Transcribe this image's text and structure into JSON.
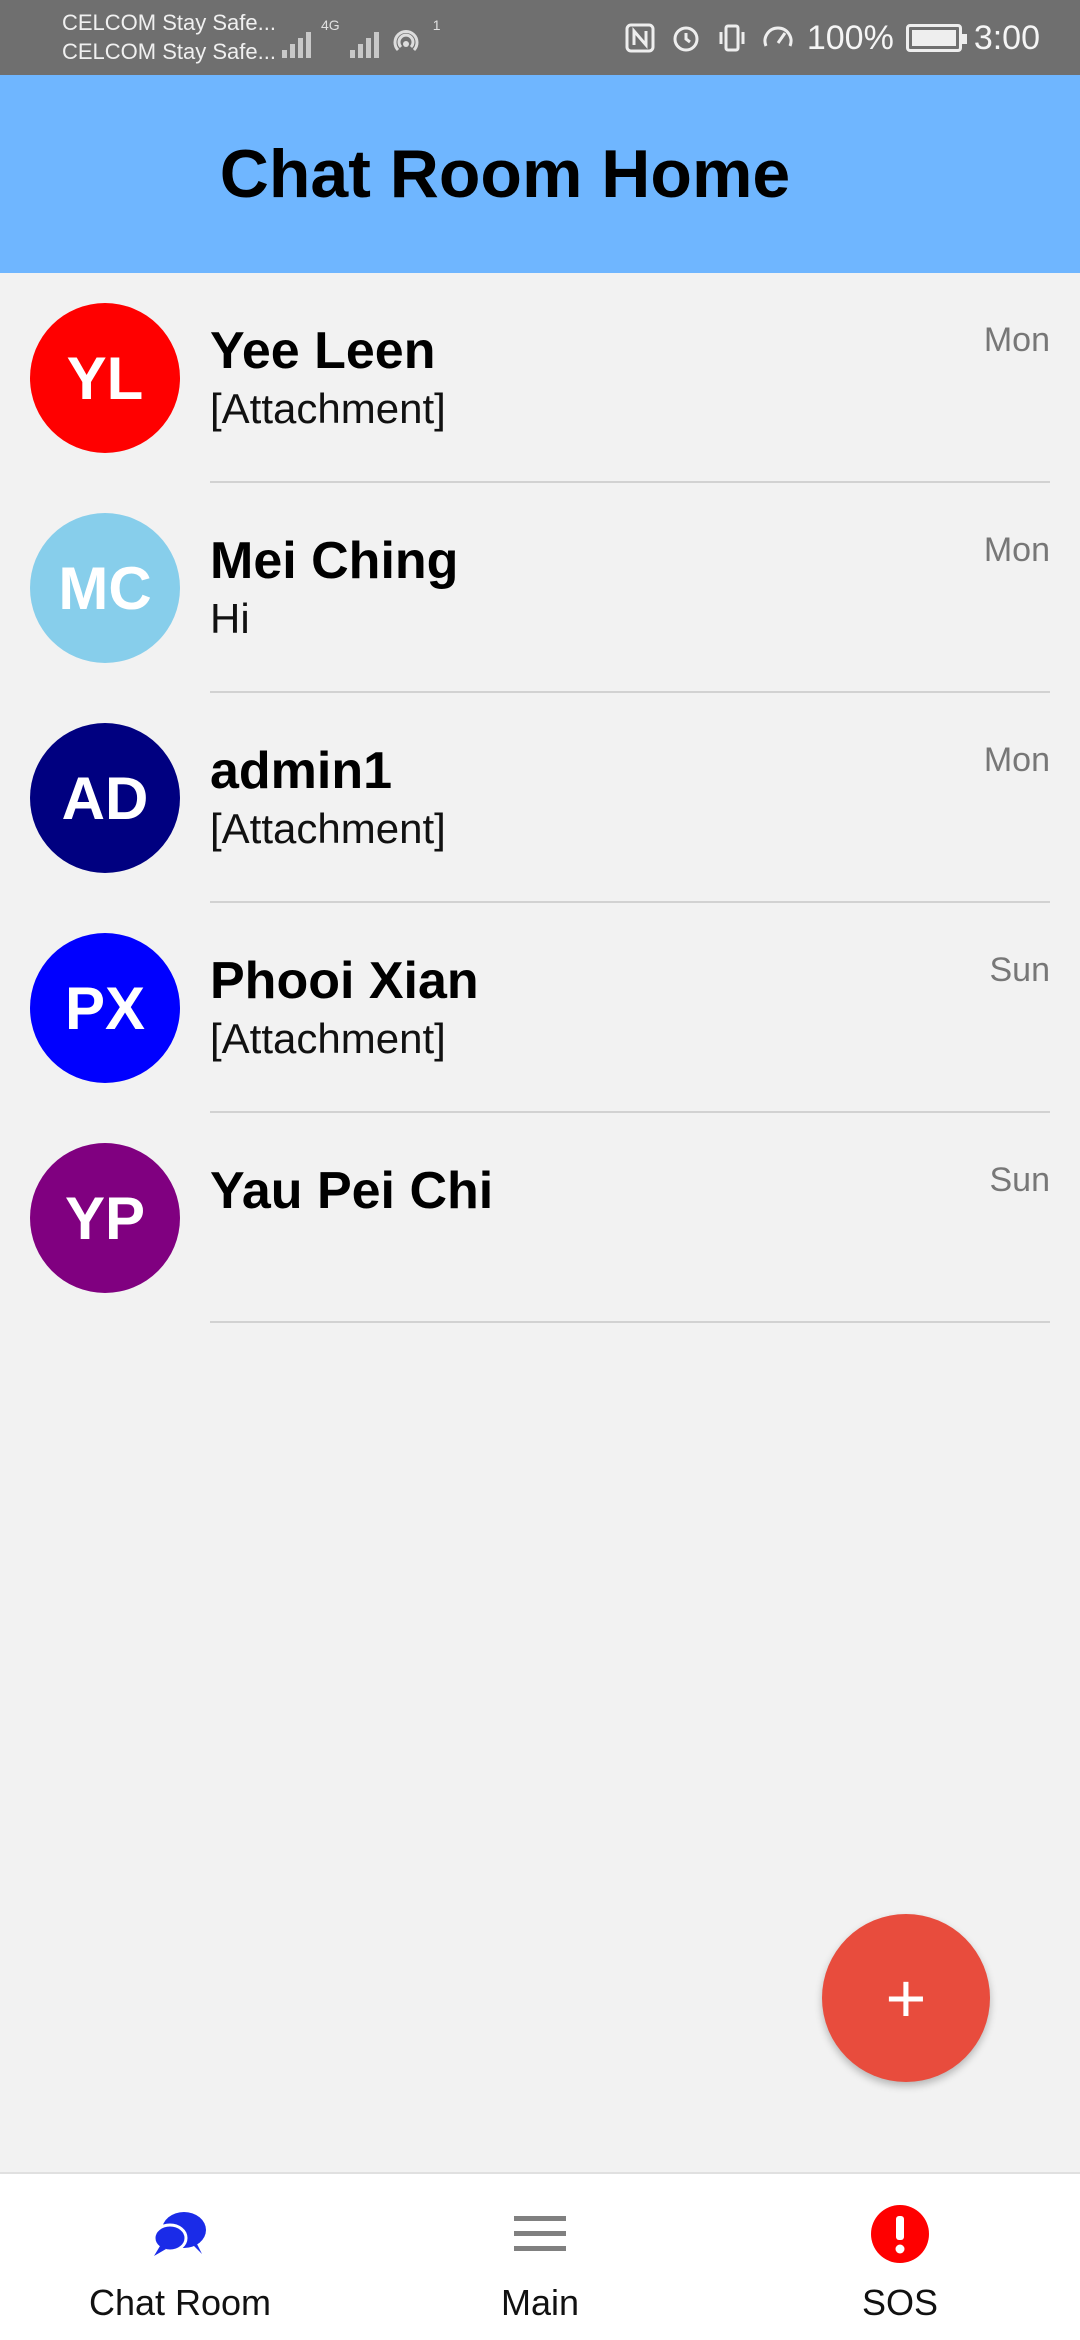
{
  "status_bar": {
    "carrier_1": "CELCOM Stay Safe...",
    "carrier_2": "CELCOM Stay Safe...",
    "network": "4G",
    "hotspot_count": "1",
    "battery": "100%",
    "time": "3:00"
  },
  "header": {
    "title": "Chat Room Home",
    "bg_color": "#6fb6ff"
  },
  "chats": [
    {
      "initials": "YL",
      "name": "Yee Leen",
      "preview": "[Attachment]",
      "time": "Mon",
      "color": "#ff0000"
    },
    {
      "initials": "MC",
      "name": "Mei Ching",
      "preview": "Hi",
      "time": "Mon",
      "color": "#87ceeb"
    },
    {
      "initials": "AD",
      "name": "admin1",
      "preview": "[Attachment]",
      "time": "Mon",
      "color": "#000080"
    },
    {
      "initials": "PX",
      "name": "Phooi Xian",
      "preview": "[Attachment]",
      "time": "Sun",
      "color": "#0000ff"
    },
    {
      "initials": "YP",
      "name": "Yau Pei Chi",
      "preview": "",
      "time": "Sun",
      "color": "#800080"
    }
  ],
  "fab": {
    "icon": "plus-icon",
    "label": "+",
    "color": "#e84c3d"
  },
  "bottom_nav": [
    {
      "label": "Chat Room",
      "icon": "chat-bubbles-icon",
      "color": "#1a2be8"
    },
    {
      "label": "Main",
      "icon": "menu-icon",
      "color": "#808080"
    },
    {
      "label": "SOS",
      "icon": "alert-icon",
      "color": "#ff0000"
    }
  ]
}
